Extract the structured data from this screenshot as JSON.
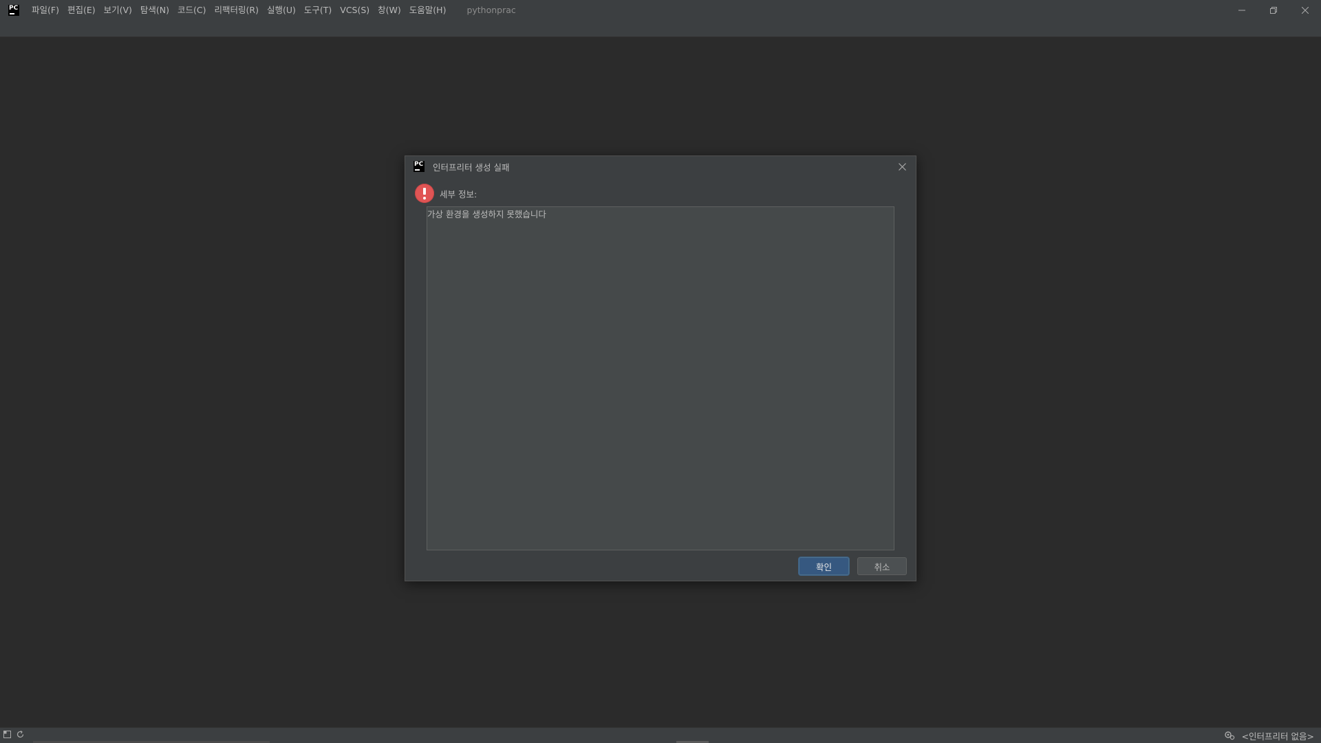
{
  "app": {
    "logo_icon": "pycharm-logo-icon",
    "project_name": "pythonprac"
  },
  "menu": [
    {
      "label": "파일(F)"
    },
    {
      "label": "편집(E)"
    },
    {
      "label": "보기(V)"
    },
    {
      "label": "탐색(N)"
    },
    {
      "label": "코드(C)"
    },
    {
      "label": "리팩터링(R)"
    },
    {
      "label": "실행(U)"
    },
    {
      "label": "도구(T)"
    },
    {
      "label": "VCS(S)"
    },
    {
      "label": "창(W)"
    },
    {
      "label": "도움말(H)"
    }
  ],
  "window_controls": {
    "minimize_icon": "minimize-icon",
    "restore_icon": "restore-icon",
    "close_icon": "close-icon"
  },
  "dialog": {
    "title": "인터프리터 생성 실패",
    "error_icon": "error-icon",
    "detail_label": "세부 정보:",
    "detail_text": "가상 환경을 생성하지 못했습니다",
    "ok_label": "확인",
    "cancel_label": "취소"
  },
  "statusbar": {
    "interpreter": "<인터프리터 없음>",
    "left_icons": [
      "window-layout-icon",
      "sync-icon"
    ],
    "right_icon": "interpreter-settings-icon"
  },
  "colors": {
    "background": "#2b2b2b",
    "panel": "#3c3f41",
    "primary_button": "#365880",
    "error": "#e05555"
  }
}
